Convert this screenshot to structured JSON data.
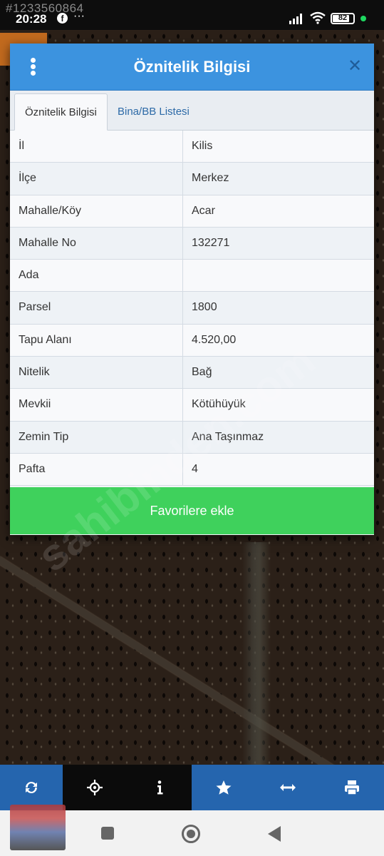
{
  "status_bar": {
    "watermark_id": "#1233560864",
    "time": "20:28",
    "fb_glyph": "f",
    "more": "···",
    "battery_level": "82",
    "battery_percent": 82
  },
  "modal": {
    "title": "Öznitelik Bilgisi",
    "tabs": [
      {
        "label": "Öznitelik Bilgisi",
        "active": true
      },
      {
        "label": "Bina/BB Listesi",
        "active": false
      }
    ],
    "rows": [
      {
        "key": "İl",
        "value": "Kilis"
      },
      {
        "key": "İlçe",
        "value": "Merkez"
      },
      {
        "key": "Mahalle/Köy",
        "value": "Acar"
      },
      {
        "key": "Mahalle No",
        "value": "132271"
      },
      {
        "key": "Ada",
        "value": ""
      },
      {
        "key": "Parsel",
        "value": "1800"
      },
      {
        "key": "Tapu Alanı",
        "value": "4.520,00"
      },
      {
        "key": "Nitelik",
        "value": "Bağ"
      },
      {
        "key": "Mevkii",
        "value": "Kötühüyük"
      },
      {
        "key": "Zemin Tip",
        "value": "Ana Taşınmaz"
      },
      {
        "key": "Pafta",
        "value": "4"
      }
    ],
    "favorite_button": "Favorilere ekle",
    "close_glyph": "✕"
  },
  "watermark_site": "sahibinden.com",
  "toolbar": {
    "icons": [
      "refresh-icon",
      "locate-icon",
      "info-icon",
      "star-icon",
      "measure-icon",
      "print-icon"
    ]
  },
  "colors": {
    "header_blue": "#3c93df",
    "button_green": "#3fd15c",
    "toolbar_blue": "#2565ae"
  }
}
